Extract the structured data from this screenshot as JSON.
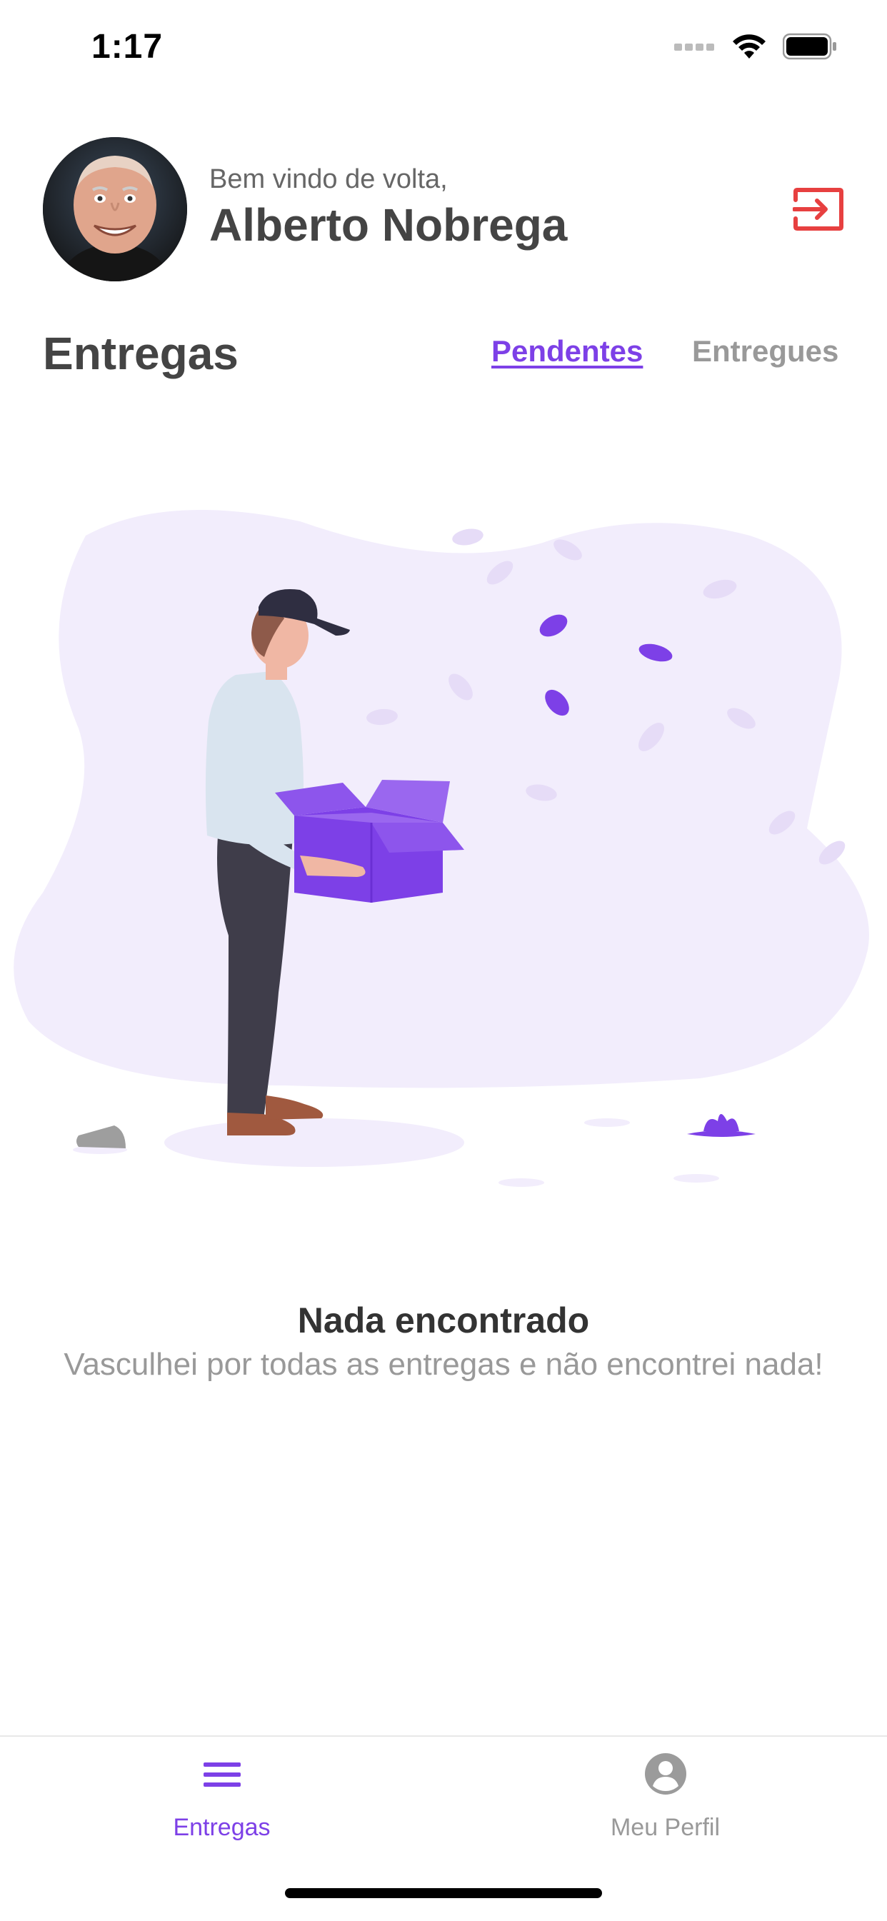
{
  "status_bar": {
    "time": "1:17"
  },
  "header": {
    "welcome": "Bem vindo de volta,",
    "user_name": "Alberto Nobrega",
    "logout_icon": "logout-icon"
  },
  "section": {
    "title": "Entregas",
    "tabs": [
      {
        "label": "Pendentes",
        "active": true
      },
      {
        "label": "Entregues",
        "active": false
      }
    ]
  },
  "empty_state": {
    "title": "Nada encontrado",
    "subtitle": "Vasculhei por todas as entregas e não encontrei nada!"
  },
  "tab_bar": {
    "items": [
      {
        "label": "Entregas",
        "icon": "menu-icon",
        "active": true
      },
      {
        "label": "Meu Perfil",
        "icon": "user-circle-icon",
        "active": false
      }
    ]
  },
  "colors": {
    "accent": "#7d40e7",
    "danger": "#e74040",
    "text_dark": "#444444",
    "text_muted": "#999999",
    "blob": "#f2edfc"
  }
}
